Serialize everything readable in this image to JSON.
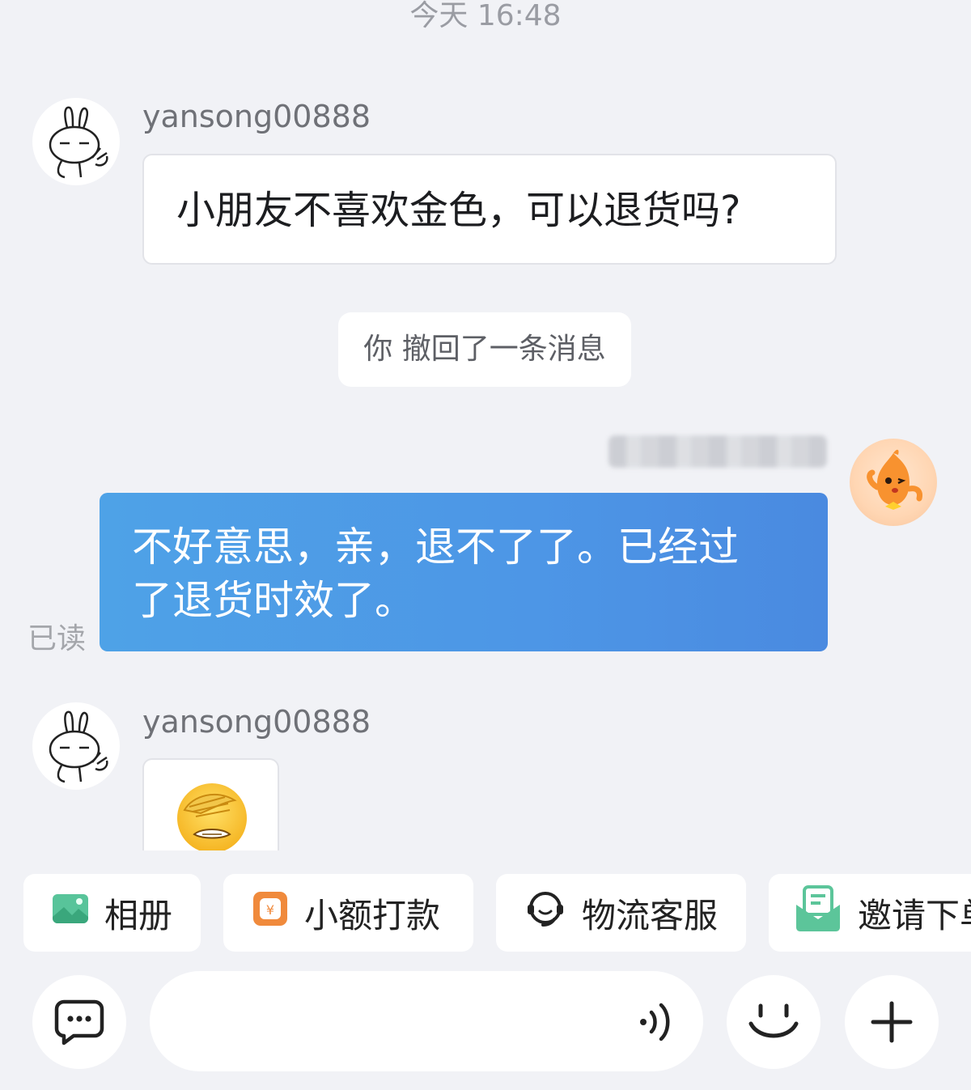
{
  "timestamp": "今天  16:48",
  "messages": [
    {
      "sender": "yansong00888",
      "text": "小朋友不喜欢金色，可以退货吗?"
    },
    {
      "system": "你 撤回了一条消息"
    },
    {
      "sender_blurred": true,
      "text_line1": "不好意思，亲，退不了了。已经过",
      "text_line2": "了退货时效了。",
      "read_status": "已读"
    },
    {
      "sender": "yansong00888",
      "emoji": "face-palm-emoji"
    }
  ],
  "quick_actions": [
    {
      "label": "相册",
      "icon": "photo-album-icon"
    },
    {
      "label": "小额打款",
      "icon": "small-payment-icon"
    },
    {
      "label": "物流客服",
      "icon": "logistics-service-icon"
    },
    {
      "label": "邀请下单",
      "icon": "invite-order-icon"
    }
  ],
  "input": {
    "placeholder": ""
  },
  "colors": {
    "background": "#f1f2f6",
    "bubble_blue": "#4d96e6",
    "chip_orange": "#f08a3c",
    "chip_green": "#5cc59a"
  }
}
